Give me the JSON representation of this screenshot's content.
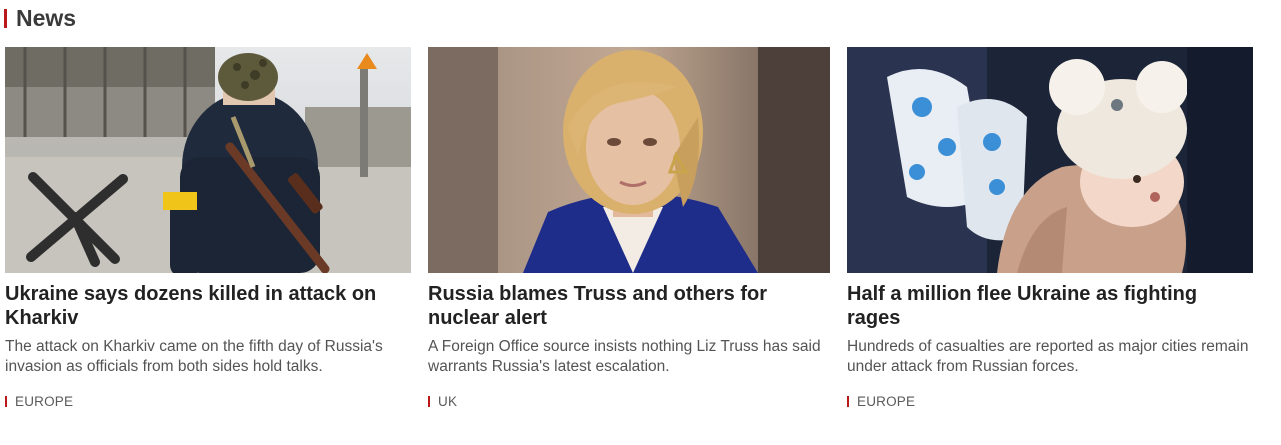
{
  "section": {
    "title": "News"
  },
  "colors": {
    "accent": "#bb1919",
    "headline": "#222222",
    "summary": "#545454"
  },
  "articles": [
    {
      "headline": "Ukraine says dozens killed in attack on Kharkiv",
      "summary": "The attack on Kharkiv came on the fifth day of Russia's invasion as officials from both sides hold talks.",
      "tag": "EUROPE",
      "image": "soldier-with-rifle-photo"
    },
    {
      "headline": "Russia blames Truss and others for nuclear alert",
      "summary": "A Foreign Office source insists nothing Liz Truss has said warrants Russia's latest escalation.",
      "tag": "UK",
      "image": "woman-portrait-photo"
    },
    {
      "headline": "Half a million flee Ukraine as fighting rages",
      "summary": "Hundreds of casualties are reported as major cities remain under attack from Russian forces.",
      "tag": "EUROPE",
      "image": "child-in-winter-hat-photo"
    }
  ]
}
